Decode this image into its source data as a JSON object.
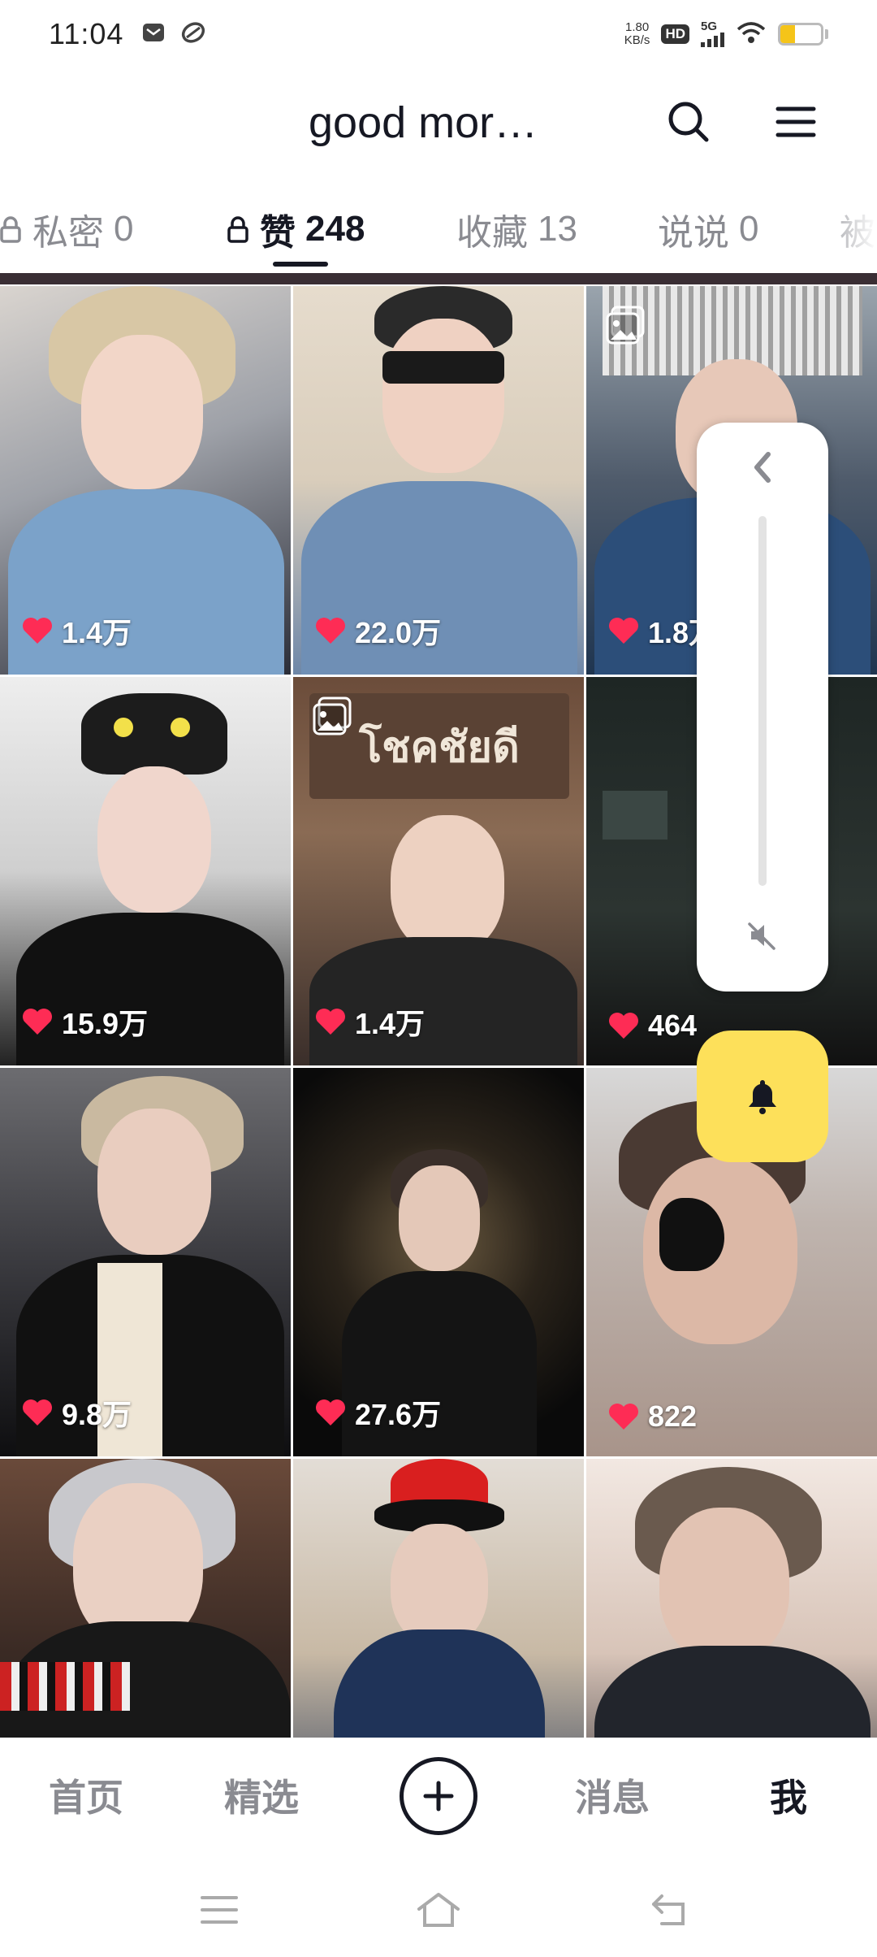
{
  "status_bar": {
    "time": "11:04",
    "net_speed_value": "1.80",
    "net_speed_unit": "KB/s",
    "hd_label": "HD",
    "signal_label": "5G",
    "battery_level": 0.35
  },
  "header": {
    "title": "good mor…"
  },
  "tabs": [
    {
      "label": "私密",
      "count": "0",
      "locked": true,
      "active": false
    },
    {
      "label": "赞",
      "count": "248",
      "locked": true,
      "active": true
    },
    {
      "label": "收藏",
      "count": "13",
      "locked": false,
      "active": false
    },
    {
      "label": "说说",
      "count": "0",
      "locked": false,
      "active": false
    },
    {
      "label": "被",
      "count": "",
      "locked": false,
      "active": false
    }
  ],
  "videos": [
    {
      "likes": "1.4万",
      "multi_image": false
    },
    {
      "likes": "22.0万",
      "multi_image": false
    },
    {
      "likes": "1.8万",
      "multi_image": true
    },
    {
      "likes": "15.9万",
      "multi_image": false
    },
    {
      "likes": "1.4万",
      "multi_image": true
    },
    {
      "likes": "464",
      "multi_image": false
    },
    {
      "likes": "9.8万",
      "multi_image": false
    },
    {
      "likes": "27.6万",
      "multi_image": false
    },
    {
      "likes": "822",
      "multi_image": false
    },
    {
      "likes": "",
      "multi_image": false
    },
    {
      "likes": "",
      "multi_image": false
    },
    {
      "likes": "",
      "multi_image": false
    }
  ],
  "tile_sign_text": "โชคชัยดี",
  "bottom_nav": {
    "home": "首页",
    "featured": "精选",
    "messages": "消息",
    "me": "我"
  },
  "colors": {
    "accent_yellow": "#fde05a",
    "like_red": "#fe2c55",
    "text_primary": "#161823",
    "text_secondary": "#8a8b91"
  },
  "icons": [
    "mail-icon",
    "sync-icon",
    "wifi-icon",
    "search-icon",
    "menu-icon",
    "lock-icon",
    "heart-icon",
    "multi-image-icon",
    "chevron-left-icon",
    "mute-icon",
    "bell-icon",
    "plus-icon",
    "recents-icon",
    "home-icon",
    "back-icon"
  ]
}
